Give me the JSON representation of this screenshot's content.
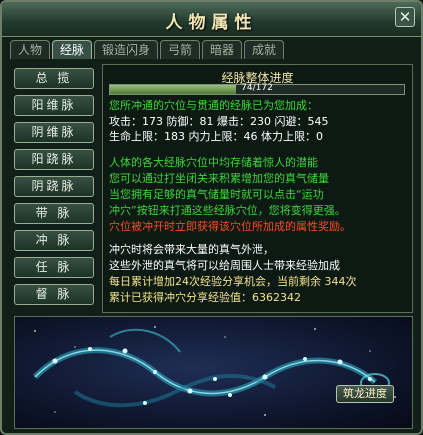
{
  "window": {
    "title": "人物属性"
  },
  "tabs": [
    {
      "label": "人物"
    },
    {
      "label": "经脉"
    },
    {
      "label": "锻造闪身"
    },
    {
      "label": "弓箭"
    },
    {
      "label": "暗器"
    },
    {
      "label": "成就"
    }
  ],
  "active_tab": "经脉",
  "sidebar": {
    "items": [
      {
        "label": "总 揽"
      },
      {
        "label": "阳维脉"
      },
      {
        "label": "阴维脉"
      },
      {
        "label": "阳跷脉"
      },
      {
        "label": "阴跷脉"
      },
      {
        "label": "带 脉"
      },
      {
        "label": "冲 脉"
      },
      {
        "label": "任 脉"
      },
      {
        "label": "督 脉"
      }
    ]
  },
  "progress": {
    "title": "经脉整体进度",
    "text": "74/172",
    "current": 74,
    "max": 172
  },
  "bonus": {
    "heading": "您所冲通的穴位与贯通的经脉已为您加成：",
    "line1": "攻击：173 防御：81 爆击：230 闪避：545",
    "line2": "生命上限：183 内力上限：46 体力上限：0"
  },
  "info": {
    "l1": "人体的各大经脉穴位中均存储着惊人的潜能",
    "l2": "您可以通过打坐闭关来积累增加您的真气储量",
    "l3": "当您拥有足够的真气储量时就可以点击“运功",
    "l4": "冲穴”按钮来打通这些经脉穴位，您将变得更强。",
    "l5": "穴位被冲开时立即获得该穴位所加成的属性奖励。"
  },
  "exp": {
    "l1": "冲穴时将会带来大量的真气外泄，",
    "l2": "这些外泄的真气将可以给周围人士带来经验加成",
    "l3": "每日累计增加24次经验分享机会，当前剩余 344次",
    "l4": "累计已获得冲穴分享经验值：6362342"
  },
  "buttons": {
    "dragon": "筑龙进度",
    "close": "✕"
  }
}
